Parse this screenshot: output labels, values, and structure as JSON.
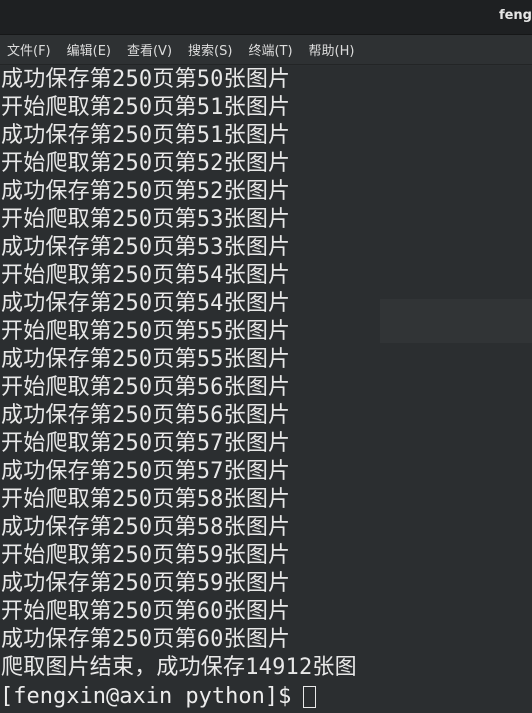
{
  "window": {
    "title": "feng"
  },
  "menubar": {
    "items": [
      {
        "label": "文件(F)",
        "name": "menu-file"
      },
      {
        "label": "编辑(E)",
        "name": "menu-edit"
      },
      {
        "label": "查看(V)",
        "name": "menu-view"
      },
      {
        "label": "搜索(S)",
        "name": "menu-search"
      },
      {
        "label": "终端(T)",
        "name": "menu-terminal"
      },
      {
        "label": "帮助(H)",
        "name": "menu-help"
      }
    ]
  },
  "terminal": {
    "lines": [
      "成功保存第250页第50张图片",
      "开始爬取第250页第51张图片",
      "成功保存第250页第51张图片",
      "开始爬取第250页第52张图片",
      "成功保存第250页第52张图片",
      "开始爬取第250页第53张图片",
      "成功保存第250页第53张图片",
      "开始爬取第250页第54张图片",
      "成功保存第250页第54张图片",
      "开始爬取第250页第55张图片",
      "成功保存第250页第55张图片",
      "开始爬取第250页第56张图片",
      "成功保存第250页第56张图片",
      "开始爬取第250页第57张图片",
      "成功保存第250页第57张图片",
      "开始爬取第250页第58张图片",
      "成功保存第250页第58张图片",
      "开始爬取第250页第59张图片",
      "成功保存第250页第59张图片",
      "开始爬取第250页第60张图片",
      "成功保存第250页第60张图片",
      "爬取图片结束，成功保存14912张图"
    ],
    "prompt": "[fengxin@axin python]$"
  }
}
